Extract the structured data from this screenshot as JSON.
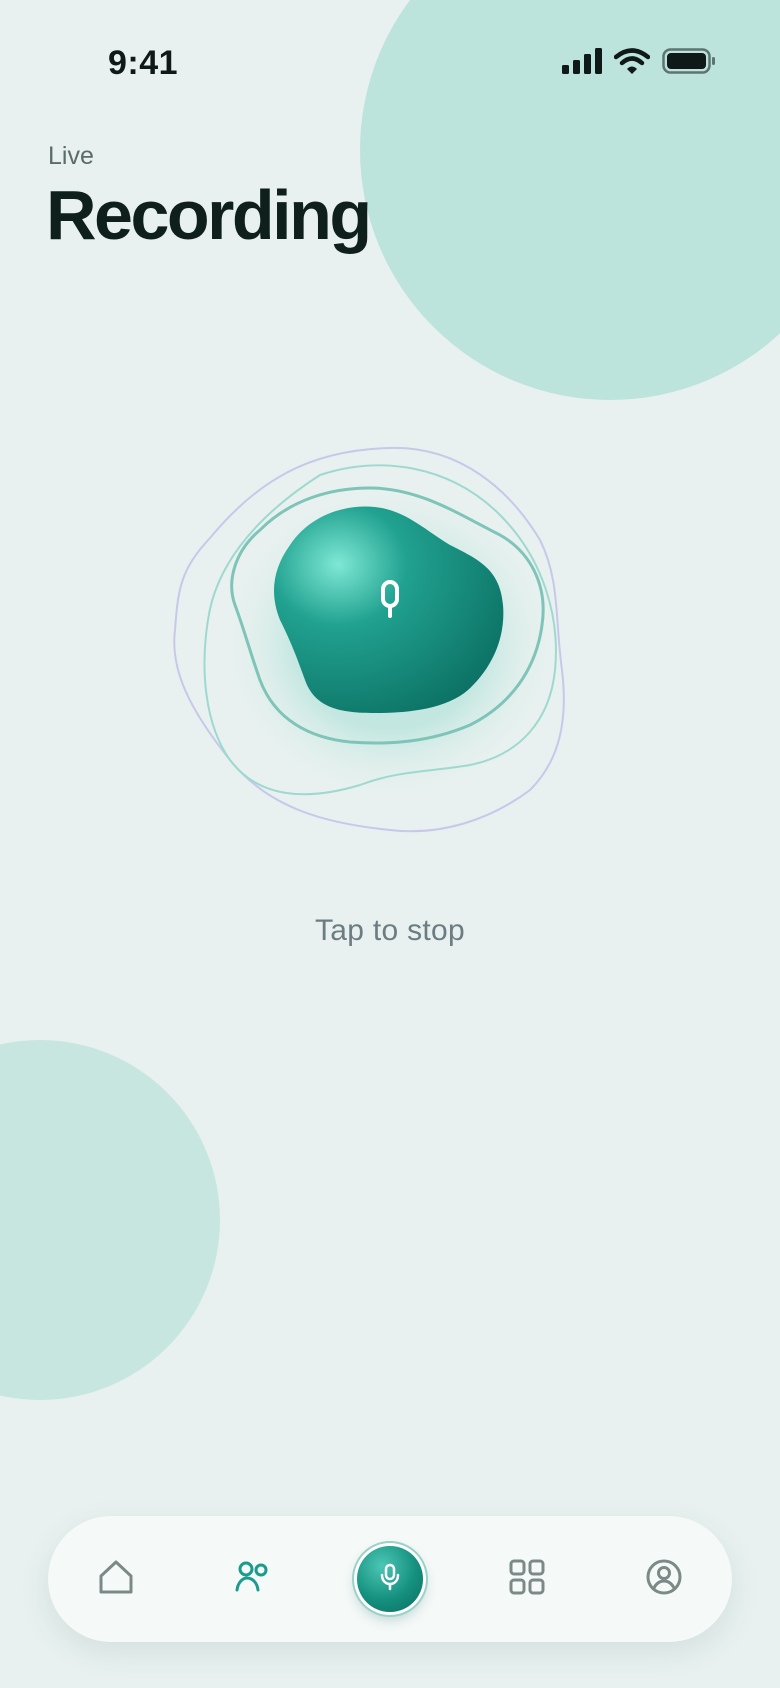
{
  "status_bar": {
    "time": "9:41",
    "icons": [
      "cellular-signal-icon",
      "wifi-icon",
      "battery-icon"
    ]
  },
  "header": {
    "eyebrow": "Live",
    "title": "Recording"
  },
  "record": {
    "button_icon": "microphone-icon",
    "hint": "Tap to stop"
  },
  "nav": {
    "items": [
      {
        "icon": "home-icon",
        "active": false
      },
      {
        "icon": "people-icon",
        "active": true
      },
      {
        "icon": "microphone-icon",
        "active": true
      },
      {
        "icon": "grid-icon",
        "active": false
      },
      {
        "icon": "profile-icon",
        "active": false
      }
    ]
  },
  "colors": {
    "background": "#e8f1ef",
    "accent": "#15907f",
    "accent_dark": "#0c6c60",
    "bubble": "#bde3dd",
    "title": "#0f1f1b",
    "hint_text": "#6b7c82"
  }
}
